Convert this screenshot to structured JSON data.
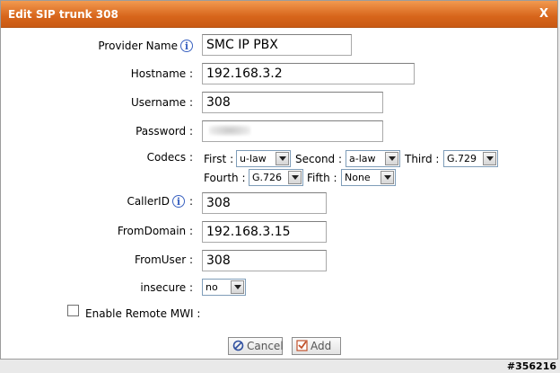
{
  "dialog": {
    "title": "Edit SIP trunk 308",
    "close_label": "X"
  },
  "form": {
    "provider_name": {
      "label": "Provider Name",
      "value": "SMC IP PBX",
      "info_icon": "info-icon"
    },
    "hostname": {
      "label": "Hostname :",
      "value": "192.168.3.2"
    },
    "username": {
      "label": "Username :",
      "value": "308"
    },
    "password": {
      "label": "Password :",
      "value": ""
    },
    "codecs": {
      "label": "Codecs :",
      "first_label": "First :",
      "first_value": "u-law",
      "second_label": "Second :",
      "second_value": "a-law",
      "third_label": "Third :",
      "third_value": "G.729",
      "fourth_label": "Fourth :",
      "fourth_value": "G.726",
      "fifth_label": "Fifth :",
      "fifth_value": "None"
    },
    "callerid": {
      "label": "CallerID",
      "colon": ":",
      "value": "308",
      "info_icon": "info-icon"
    },
    "fromdomain": {
      "label": "FromDomain :",
      "value": "192.168.3.15"
    },
    "fromuser": {
      "label": "FromUser :",
      "value": "308"
    },
    "insecure": {
      "label": "insecure :",
      "value": "no"
    },
    "remote_mwi": {
      "label": "Enable Remote MWI :",
      "checked": false
    }
  },
  "buttons": {
    "cancel_label": "Cancel",
    "add_label": "Add"
  },
  "watermark": "#356216",
  "colors": {
    "title_bar": "#d7651b",
    "info_icon": "#3a62c0"
  }
}
